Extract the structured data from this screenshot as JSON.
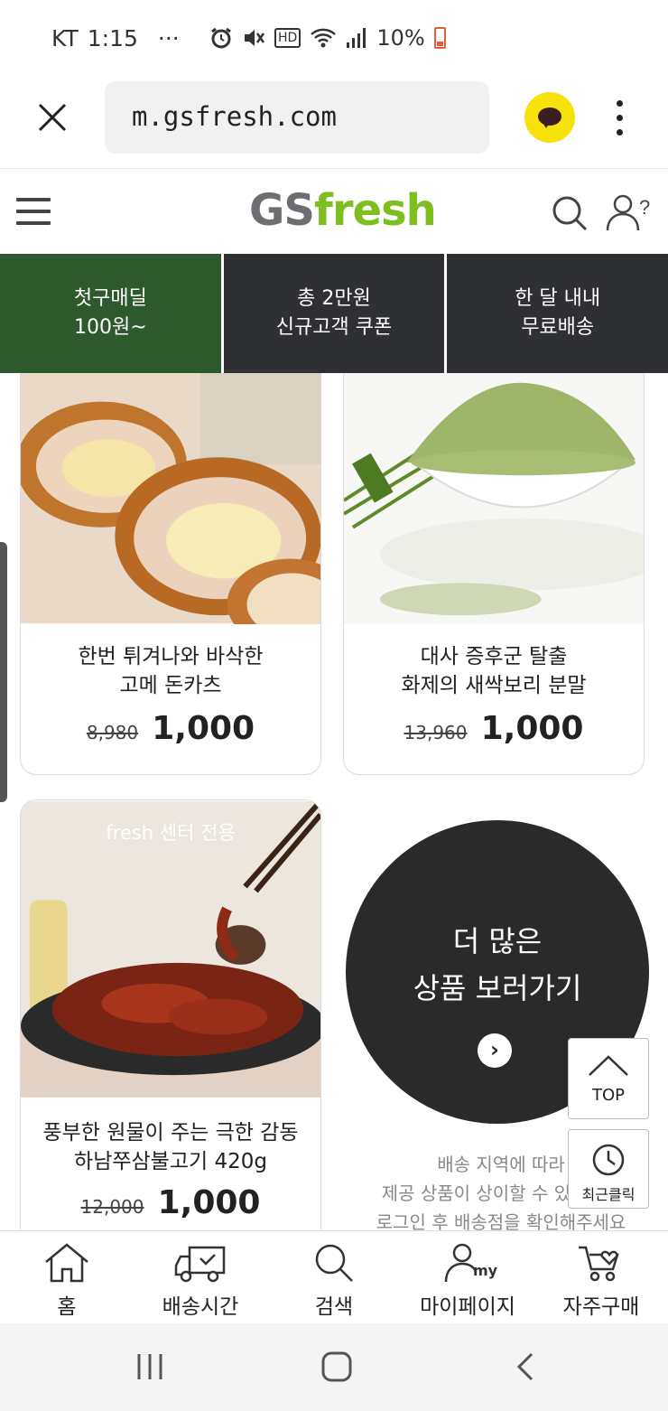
{
  "status_bar": {
    "carrier": "KT",
    "time": "1:15",
    "dots": "···",
    "net_label": "HD",
    "battery": "10%",
    "battery_color": "#e35d3a"
  },
  "browser": {
    "url": "m.gsfresh.com",
    "close_icon": "close-icon",
    "share_icon": "kakaotalk-icon",
    "menu_icon": "more-vertical-icon"
  },
  "header": {
    "logo_gs": "GS",
    "logo_fresh": "fresh",
    "brand_gray": "#6d6e71",
    "brand_green": "#7cbf1e",
    "menu_icon": "hamburger-icon",
    "search_icon": "search-icon",
    "user_icon": "user-help-icon"
  },
  "promo_tabs": [
    {
      "line1": "첫구매딜",
      "line2": "100원~",
      "active": true
    },
    {
      "line1": "총 2만원",
      "line2": "신규고객 쿠폰",
      "active": false
    },
    {
      "line1": "한 달 내내",
      "line2": "무료배송",
      "active": false
    }
  ],
  "products": [
    {
      "line1": "한번 튀겨나와 바삭한",
      "line2": "고메 돈카츠",
      "original_price": "8,980",
      "sale_price": "1,000"
    },
    {
      "line1": "대사 증후군 탈출",
      "line2": "화제의 새싹보리 분말",
      "original_price": "13,960",
      "sale_price": "1,000"
    },
    {
      "badge": "fresh 센터 전용",
      "line1": "풍부한 원물이 주는 극한 감동",
      "line2": "하남쭈삼불고기 420g",
      "original_price": "12,000",
      "sale_price": "1,000"
    }
  ],
  "more": {
    "line1": "더 많은",
    "line2": "상품 보러가기",
    "arrow": "›"
  },
  "notice": {
    "line1": "배송 지역에 따라",
    "line2": "제공 상품이 상이할 수 있습니다",
    "line3": "로그인 후 배송점을 확인해주세요"
  },
  "floating": {
    "top": "TOP",
    "recent": "최근클릭"
  },
  "bottom_nav": [
    {
      "label": "홈",
      "icon": "home-icon"
    },
    {
      "label": "배송시간",
      "icon": "delivery-truck-icon"
    },
    {
      "label": "검색",
      "icon": "search-icon"
    },
    {
      "label": "마이페이지",
      "icon": "my-page-icon",
      "icon_text": "my"
    },
    {
      "label": "자주구매",
      "icon": "cart-heart-icon"
    }
  ]
}
